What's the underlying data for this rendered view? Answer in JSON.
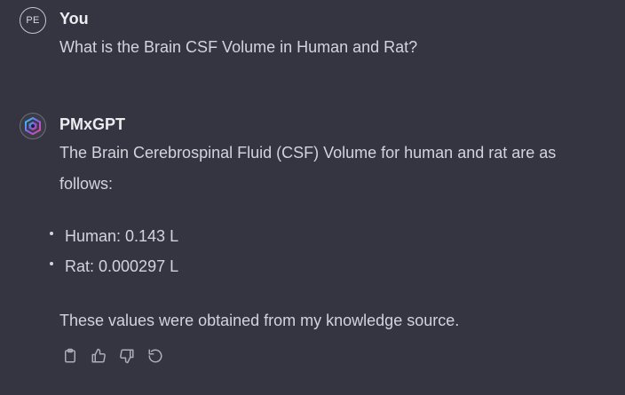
{
  "user": {
    "avatar_initials": "PE",
    "name": "You",
    "message": "What is the Brain CSF Volume in Human and Rat?"
  },
  "assistant": {
    "name": "PMxGPT",
    "intro": "The Brain Cerebrospinal Fluid (CSF) Volume for human and rat are as follows:",
    "bullets": [
      "Human: 0.143 L",
      "Rat: 0.000297 L"
    ],
    "closing": "These values were obtained from my knowledge source."
  },
  "actions": [
    "clipboard-icon",
    "thumbs-up-icon",
    "thumbs-down-icon",
    "regenerate-icon"
  ],
  "colors": {
    "background": "#343541",
    "text": "#d1d5db",
    "heading": "#ececf1",
    "accent": "#8b5cf6"
  }
}
